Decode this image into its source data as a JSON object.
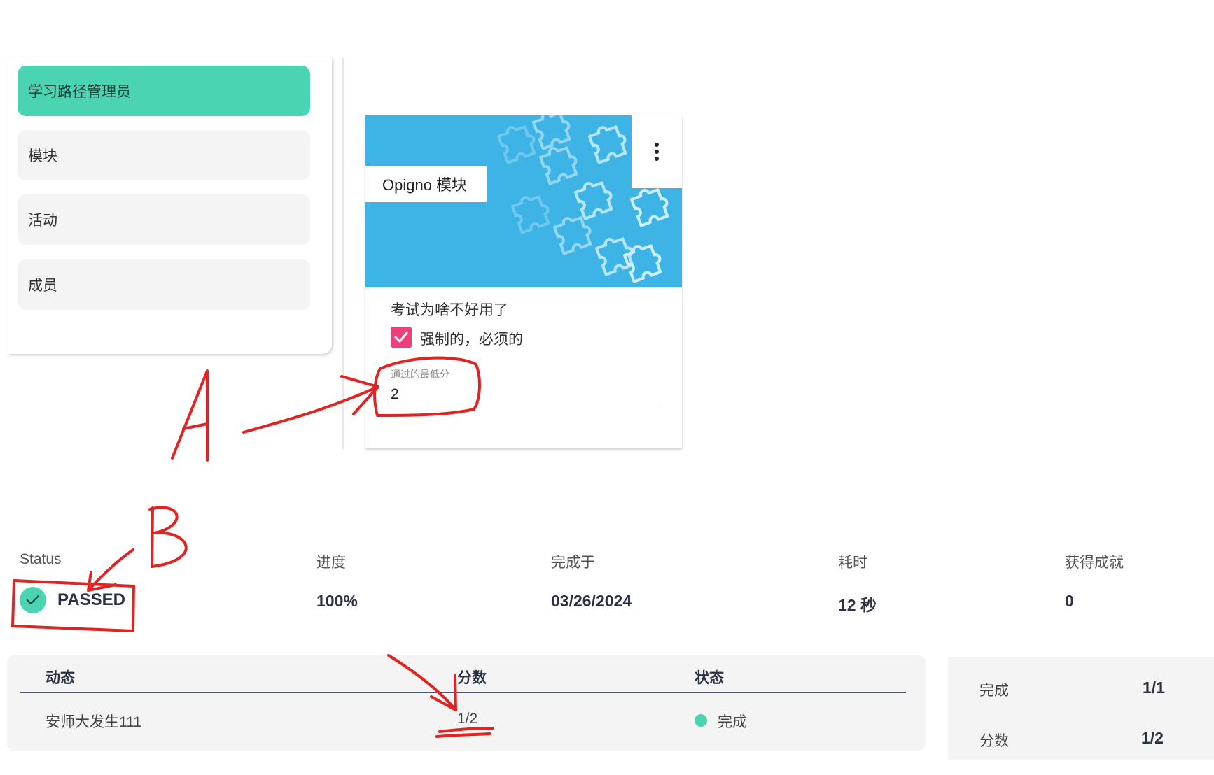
{
  "sidebar": {
    "items": [
      {
        "label": "学习路径管理员"
      },
      {
        "label": "模块"
      },
      {
        "label": "活动"
      },
      {
        "label": "成员"
      }
    ]
  },
  "card": {
    "badge": "Opigno 模块",
    "title": "考试为啥不好用了",
    "mandatory_label": "强制的，必须的",
    "mandatory_checked": true,
    "min_score_label": "通过的最低分",
    "min_score_value": "2"
  },
  "stats": {
    "status_label": "Status",
    "status_value": "PASSED",
    "progress_label": "进度",
    "progress_value": "100%",
    "completed_label": "完成于",
    "completed_value": "03/26/2024",
    "time_label": "耗时",
    "time_value": "12 秒",
    "achievements_label": "获得成就",
    "achievements_value": "0"
  },
  "table": {
    "headers": {
      "activity": "动态",
      "score": "分数",
      "state": "状态"
    },
    "rows": [
      {
        "activity": "安师大发生111",
        "score": "1/2",
        "state": "完成"
      }
    ]
  },
  "summary": {
    "completed_label": "完成",
    "completed_value": "1/1",
    "score_label": "分数",
    "score_value": "1/2"
  },
  "annotations": {
    "a": "A",
    "b": "B"
  },
  "colors": {
    "accent": "#4bd4b2",
    "banner": "#3db3e6",
    "checkbox": "#ef3f7a",
    "annotation": "#e32222"
  }
}
